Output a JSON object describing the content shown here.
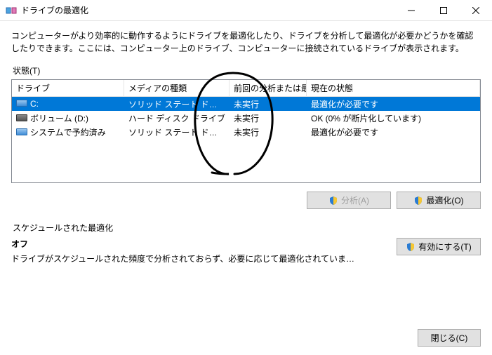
{
  "window": {
    "title": "ドライブの最適化",
    "description": "コンピューターがより効率的に動作するようにドライブを最適化したり、ドライブを分析して最適化が必要かどうかを確認したりできます。ここには、コンピューター上のドライブ、コンピューターに接続されているドライブが表示されます。"
  },
  "status_section": {
    "label": "状態(T)",
    "columns": {
      "drive": "ドライブ",
      "media": "メディアの種類",
      "last": "前回の分析または最…",
      "status": "現在の状態"
    },
    "rows": [
      {
        "icon": "ssd",
        "drive": "C:",
        "media": "ソリッド ステート ドライブ",
        "last": "未実行",
        "status": "最適化が必要です",
        "selected": true
      },
      {
        "icon": "hdd",
        "drive": "ボリューム (D:)",
        "media": "ハード ディスク ドライブ",
        "last": "未実行",
        "status": "OK (0% が断片化しています)",
        "selected": false
      },
      {
        "icon": "ssd",
        "drive": "システムで予約済み",
        "media": "ソリッド ステート ドライブ",
        "last": "未実行",
        "status": "最適化が必要です",
        "selected": false
      }
    ],
    "buttons": {
      "analyze": "分析(A)",
      "optimize": "最適化(O)"
    }
  },
  "schedule_section": {
    "label": "スケジュールされた最適化",
    "state_label": "オフ",
    "state_desc": "ドライブがスケジュールされた頻度で分析されておらず、必要に応じて最適化されていま…",
    "enable_button": "有効にする(T)"
  },
  "footer": {
    "close": "閉じる(C)"
  }
}
